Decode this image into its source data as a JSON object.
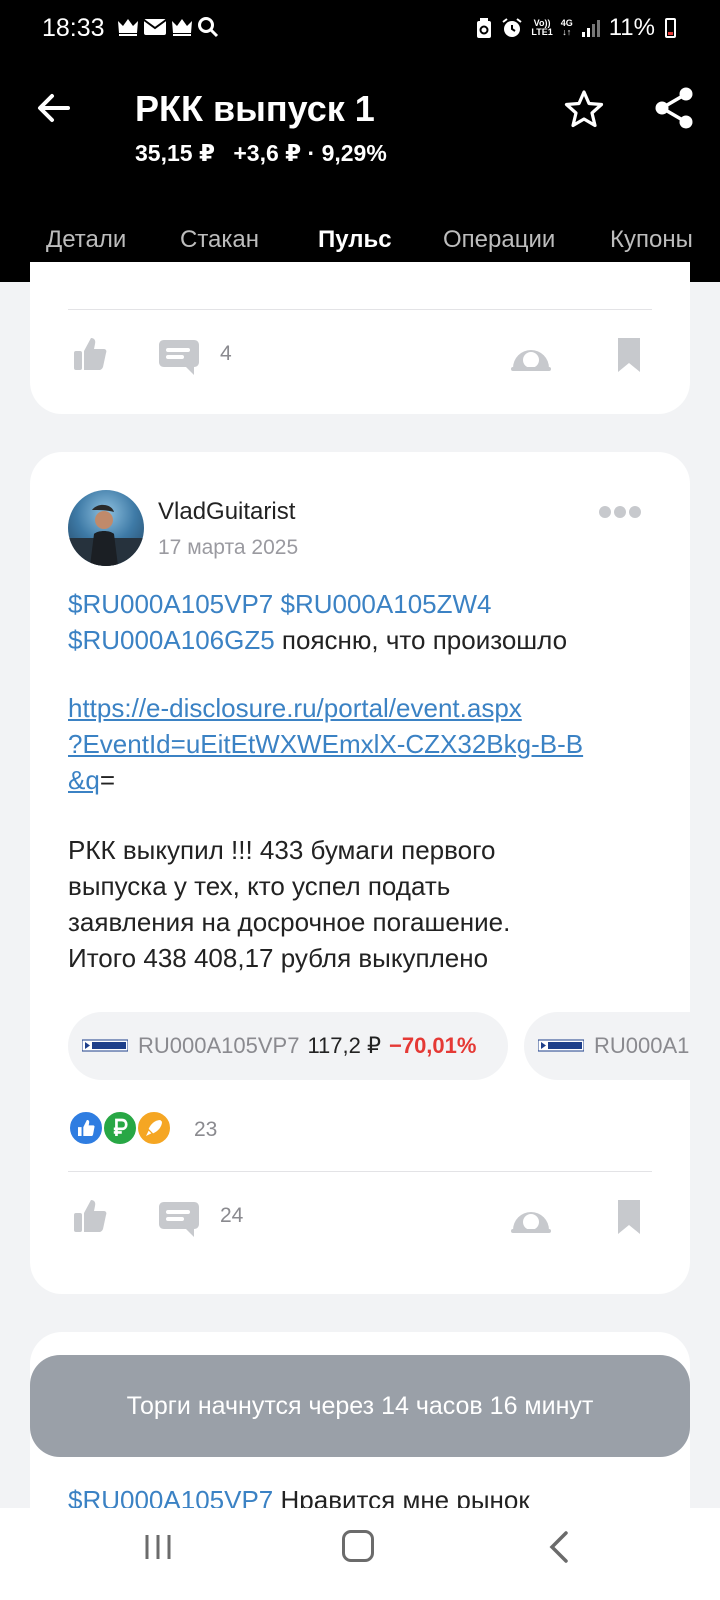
{
  "status_bar": {
    "time": "18:33",
    "network_top": "Vo))",
    "network_bottom": "LTE1",
    "net_type": "4G",
    "battery": "11%"
  },
  "header": {
    "title": "РКК выпуск 1",
    "price": "35,15 ₽",
    "change": "+3,6 ₽ · 9,29%"
  },
  "tabs": [
    {
      "label": "Детали"
    },
    {
      "label": "Стакан"
    },
    {
      "label": "Пульс"
    },
    {
      "label": "Операции"
    },
    {
      "label": "Купоны"
    }
  ],
  "active_tab": "Пульс",
  "post_prev": {
    "comments": "4"
  },
  "post_main": {
    "author": "VladGuitarist",
    "date": "17 марта 2025",
    "tickers": [
      "$RU000A105VP7",
      "$RU000A105ZW4",
      "$RU000A106GZ5"
    ],
    "text_after_tickers": "поясню, что произошло",
    "link_lines": [
      "https://e-disclosure.ru/portal/event.aspx",
      "?EventId=uEitEtWXWEmxlX-CZX32Bkg-B-B",
      "&q"
    ],
    "link_suffix": "=",
    "body_lines": [
      "РКК выкупил !!! 433 бумаги первого",
      "выпуска у тех, кто успел подать",
      "заявления на досрочное погашение.",
      "Итого 438 408,17 рубля выкуплено"
    ],
    "chips": [
      {
        "code": "RU000A105VP7",
        "price": "117,2 ₽",
        "change": "−70,01%"
      },
      {
        "code": "RU000A1"
      }
    ],
    "reactions_count": "23",
    "comments": "24"
  },
  "post_next": {
    "ticker": "$RU000A105VP7",
    "text": "Нравится мне рынок"
  },
  "toast": "Торги начнутся через 14 часов 16 минут",
  "colors": {
    "link": "#3b82c4",
    "negative": "#e53935",
    "header_bg": "#000000",
    "toast_bg": "#9aa0a8"
  }
}
